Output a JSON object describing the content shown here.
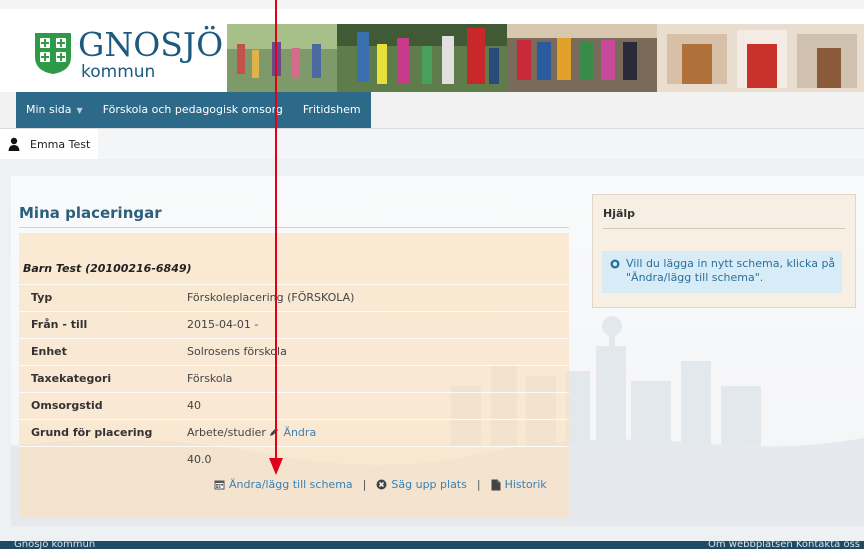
{
  "header": {
    "logo_name": "GNOSJÖ",
    "logo_sub": "kommun"
  },
  "nav": {
    "items": [
      {
        "label": "Min sida",
        "has_caret": true
      },
      {
        "label": "Förskola och pedagogisk omsorg"
      },
      {
        "label": "Fritidshem"
      }
    ]
  },
  "user": {
    "name": "Emma Test"
  },
  "main": {
    "title": "Mina placeringar",
    "child": "Barn Test (20100216-6849)",
    "rows": [
      {
        "label": "Typ",
        "value": "Förskoleplacering  (FÖRSKOLA)"
      },
      {
        "label": "Från - till",
        "value": "2015-04-01 -"
      },
      {
        "label": "Enhet",
        "value": "Solrosens förskola"
      },
      {
        "label": "Taxekategori",
        "value": "Förskola"
      },
      {
        "label": "Omsorgstid",
        "value": "40"
      },
      {
        "label": "Grund för placering",
        "value": "Arbete/studier",
        "edit_label": "Ändra"
      },
      {
        "label": "",
        "value": "40.0"
      }
    ],
    "links": {
      "schedule": "Ändra/lägg till schema",
      "sep": "|",
      "cancel": "Säg upp plats",
      "history": "Historik"
    }
  },
  "help": {
    "title": "Hjälp",
    "text": "Vill du lägga in nytt schema, klicka på \"Ändra/lägg till schema\"."
  },
  "footer": {
    "left": "Gnosjö kommun",
    "right": "Om webbplatsen  Kontakta oss"
  },
  "colors": {
    "nav_bg": "#2d6a8a",
    "link": "#3a81b3",
    "title": "#2c5f7c",
    "card": "#fae0be",
    "help_bg": "#f7efe3",
    "help_box": "#d8ecf7",
    "annotation_arrow": "#e0001a",
    "footer": "#1f4a66"
  }
}
